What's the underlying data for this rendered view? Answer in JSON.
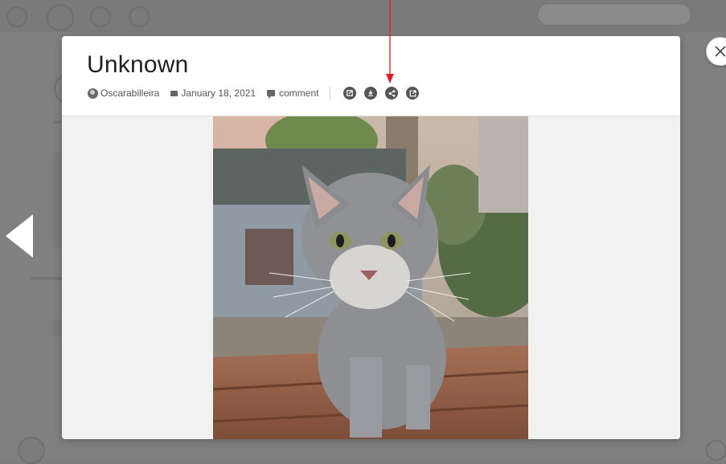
{
  "post": {
    "title": "Unknown",
    "author": "Oscarabilleira",
    "date": "January 18, 2021",
    "comment_label": "comment"
  },
  "actions": [
    {
      "name": "edit-icon"
    },
    {
      "name": "download-icon"
    },
    {
      "name": "share-icon"
    },
    {
      "name": "open-external-icon"
    }
  ],
  "photo": {
    "subject_icon": "cat-photo"
  },
  "colors": {
    "overlay": "#808080",
    "modal_bg": "#ffffff",
    "body_bg": "#f1f1f1",
    "icon": "#555555",
    "annotation": "#e02020"
  }
}
